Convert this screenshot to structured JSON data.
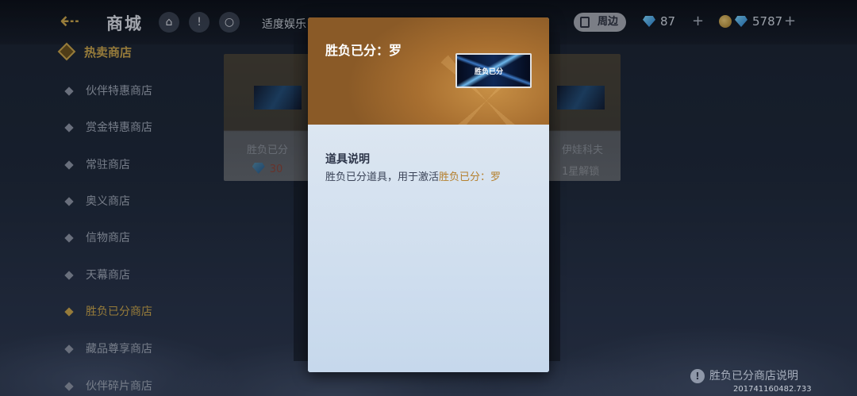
{
  "header": {
    "title": "商城",
    "marquee": "适度娱乐",
    "zhoubian_label": "周边",
    "gems": "87",
    "coins_overlap": "5787"
  },
  "sidebar": {
    "heading": "热卖商店",
    "items": [
      {
        "label": "伙伴特惠商店",
        "active": false
      },
      {
        "label": "赏金特惠商店",
        "active": false
      },
      {
        "label": "常驻商店",
        "active": false
      },
      {
        "label": "奥义商店",
        "active": false
      },
      {
        "label": "信物商店",
        "active": false
      },
      {
        "label": "天幕商店",
        "active": false
      },
      {
        "label": "胜负已分商店",
        "active": true
      },
      {
        "label": "藏品尊享商店",
        "active": false
      },
      {
        "label": "伙伴碎片商店",
        "active": false
      }
    ]
  },
  "background_cards": {
    "left": {
      "name": "胜负已分",
      "price": "30"
    },
    "right": {
      "name": "伊娃科夫",
      "price": "1星解锁"
    }
  },
  "modal": {
    "title": "胜负已分：罗",
    "thumb_text": "胜负已分",
    "section_heading": "道具说明",
    "desc_prefix": "胜负已分道具，用于激活",
    "desc_highlight": "胜负已分：罗"
  },
  "footer": {
    "help_text": "胜负已分商店说明",
    "version": "201741160482.733"
  },
  "colors": {
    "accent_gold": "#c9a54e",
    "highlight_text": "#b5802f"
  }
}
